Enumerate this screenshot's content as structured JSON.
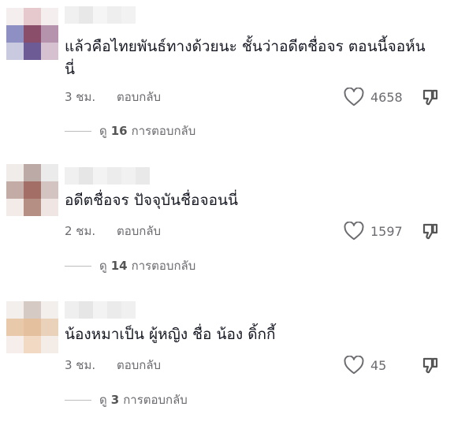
{
  "comments": [
    {
      "text": "แล้วคือไทยพันธ์ทางด้วยนะ ชั้นว่าอดีตชื่อจร ตอนนี้จอห์นนี่",
      "time": "3 ชม.",
      "reply_label": "ตอบกลับ",
      "likes": "4658",
      "view_prefix": "ดู",
      "reply_count": "16",
      "view_suffix": "การตอบกลับ",
      "avatar_colors": [
        "#f4eeee",
        "#e6c9cd",
        "#f4eeee",
        "#8e90c4",
        "#8a4d6a",
        "#b593ad",
        "#c9c9df",
        "#6c5b95",
        "#d6c1d0"
      ]
    },
    {
      "text": "อดีตชื่อจร ปัจจุบันชื่อจอนนี่",
      "time": "2 ชม.",
      "reply_label": "ตอบกลับ",
      "likes": "1597",
      "view_prefix": "ดู",
      "reply_count": "14",
      "view_suffix": "การตอบกลับ",
      "avatar_colors": [
        "#f0ecea",
        "#bcaaa6",
        "#ecebeb",
        "#c3aba6",
        "#a36e66",
        "#d3c3c1",
        "#f2ebe8",
        "#b58e84",
        "#efe5e3"
      ]
    },
    {
      "text": "น้องหมาเป็น ผู้หญิง ชื่อ น้อง ดิ้กกี้",
      "time": "3 ชม.",
      "reply_label": "ตอบกลับ",
      "likes": "45",
      "view_prefix": "ดู",
      "reply_count": "3",
      "view_suffix": "การตอบกลับ",
      "avatar_colors": [
        "#f3efec",
        "#d5cbc4",
        "#f3efec",
        "#e8c9a9",
        "#e5c09e",
        "#ead1ba",
        "#f5eeea",
        "#f1d9c3",
        "#f4ece6"
      ]
    }
  ]
}
